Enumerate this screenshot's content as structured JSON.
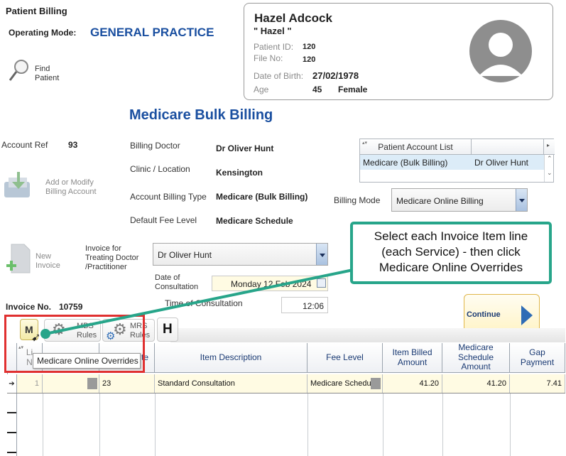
{
  "header": {
    "title": "Patient Billing",
    "operating_mode_label": "Operating Mode:",
    "operating_mode_value": "GENERAL PRACTICE",
    "find_patient_label": "Find\nPatient"
  },
  "patient": {
    "name": "Hazel Adcock",
    "nickname": "\" Hazel \"",
    "id_label": "Patient ID:",
    "id_value": "120",
    "file_label": "File No:",
    "file_value": "120",
    "dob_label": "Date of Birth:",
    "dob_value": "27/02/1978",
    "age_label": "Age",
    "age_value": "45",
    "gender": "Female"
  },
  "section_title": "Medicare Bulk Billing",
  "account": {
    "ref_label": "Account Ref",
    "ref_value": "93",
    "add_modify_label": "Add or Modify\nBilling Account",
    "billing_doctor_label": "Billing Doctor",
    "billing_doctor_value": "Dr Oliver Hunt",
    "clinic_label": "Clinic / Location",
    "clinic_value": "Kensington",
    "billing_type_label": "Account Billing Type",
    "billing_type_value": "Medicare (Bulk Billing)",
    "fee_level_label": "Default Fee Level",
    "fee_level_value": "Medicare Schedule"
  },
  "account_list": {
    "header": "Patient Account List",
    "rows": [
      {
        "type": "Medicare (Bulk Billing)",
        "doctor": "Dr Oliver Hunt"
      }
    ]
  },
  "billing_mode": {
    "label": "Billing Mode",
    "value": "Medicare Online Billing"
  },
  "invoice": {
    "new_invoice_label": "New\nInvoice",
    "treating_doctor_label": "Invoice for\nTreating Doctor\n/Practitioner",
    "treating_doctor_value": "Dr Oliver Hunt",
    "date_label": "Date of\nConsultation",
    "date_value": "Monday 12 Feb 2024",
    "time_label": "Time of Consultation",
    "time_value": "12:06",
    "number_label": "Invoice No.",
    "number_value": "10759",
    "continue_label": "Continue"
  },
  "toolbar": {
    "m_label": "M",
    "mbs_label": "MBS\nRules",
    "mrs_label": "MRS\nRules",
    "h_label": "H",
    "tooltip": "Medicare Online Overrides"
  },
  "grid": {
    "headers": [
      "Li\nN",
      "",
      "Ite",
      "Item Description",
      "Fee Level",
      "Item Billed\nAmount",
      "Medicare\nSchedule\nAmount",
      "Gap\nPayment"
    ],
    "rows": [
      {
        "line": "1",
        "item": "23",
        "description": "Standard Consultation",
        "fee_level": "Medicare Schedule",
        "billed": "41.20",
        "schedule": "41.20",
        "gap": "7.41"
      }
    ]
  },
  "callout": {
    "text": "Select each Invoice Item line\n(each Service) - then click\nMedicare Online Overrides"
  },
  "colors": {
    "accent_blue": "#1a4fa0",
    "callout_green": "#27a58a",
    "highlight_red": "#e03030",
    "row_highlight": "#fffbe3",
    "selection_blue": "#dcecf8"
  }
}
